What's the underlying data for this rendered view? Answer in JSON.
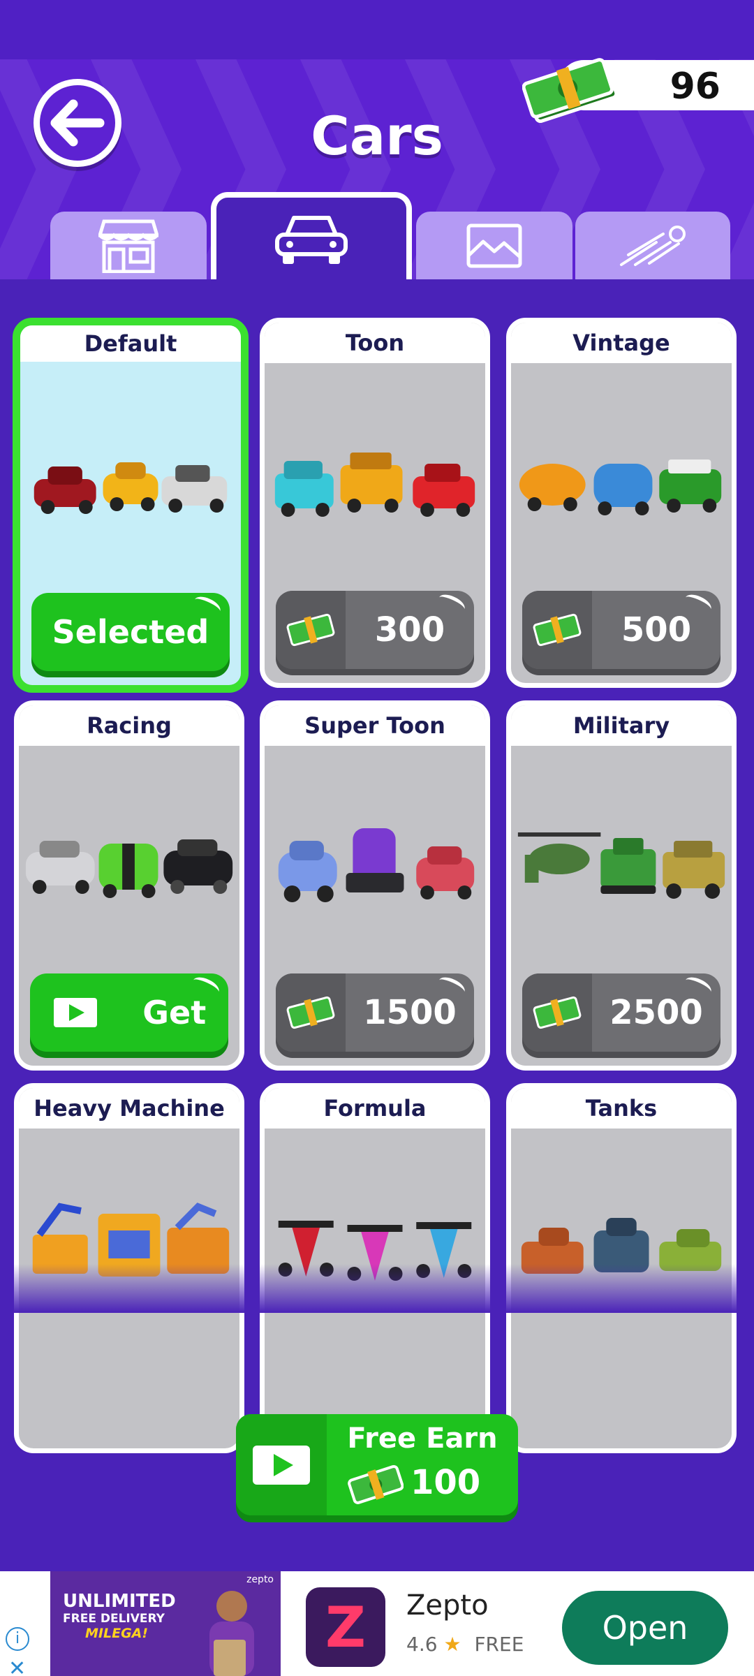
{
  "header": {
    "title": "Cars",
    "coins": "96"
  },
  "tabs": [
    {
      "name": "store-icon",
      "active": false
    },
    {
      "name": "car-icon",
      "active": true
    },
    {
      "name": "landscape-icon",
      "active": false
    },
    {
      "name": "speed-trail-icon",
      "active": false
    }
  ],
  "cards": [
    {
      "title": "Default",
      "action": "Selected"
    },
    {
      "title": "Toon",
      "price": "300"
    },
    {
      "title": "Vintage",
      "price": "500"
    },
    {
      "title": "Racing",
      "action": "Get"
    },
    {
      "title": "Super Toon",
      "price": "1500"
    },
    {
      "title": "Military",
      "price": "2500"
    },
    {
      "title": "Heavy Machine"
    },
    {
      "title": "Formula"
    },
    {
      "title": "Tanks"
    }
  ],
  "free_earn": {
    "label": "Free Earn",
    "amount": "100"
  },
  "ad": {
    "banner_line1": "UNLIMITED",
    "banner_line2": "FREE DELIVERY",
    "banner_line3": "MILEGA!",
    "banner_brand": "zepto",
    "app_icon_letter": "Z",
    "app_name": "Zepto",
    "rating": "4.6",
    "price": "FREE",
    "open_label": "Open"
  },
  "colors": {
    "background": "#4a22b8",
    "header": "#5d22d2",
    "green": "#1ec21e",
    "tab_inactive": "#b49af4"
  }
}
